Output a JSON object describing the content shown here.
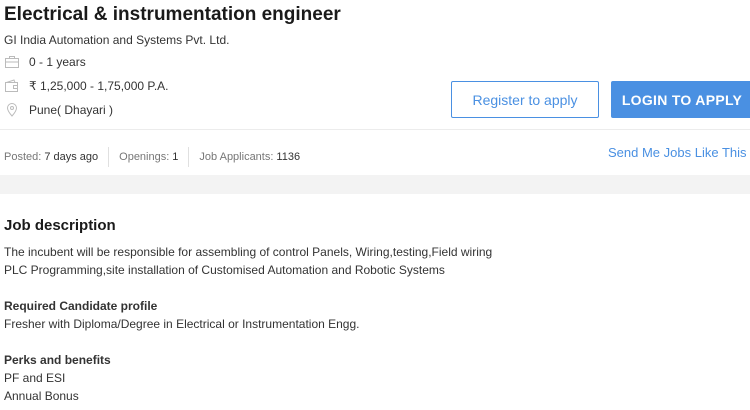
{
  "job": {
    "title": "Electrical & instrumentation engineer",
    "company": "GI India Automation and Systems Pvt. Ltd.",
    "experience": "0 - 1 years",
    "salary": "₹ 1,25,000 - 1,75,000 P.A.",
    "location": "Pune( Dhayari )"
  },
  "actions": {
    "register_label": "Register to apply",
    "login_label": "LOGIN TO APPLY",
    "send_jobs_label": "Send Me Jobs Like This"
  },
  "stats": {
    "posted_label": "Posted:",
    "posted_value": "7 days ago",
    "openings_label": "Openings:",
    "openings_value": "1",
    "applicants_label": "Job Applicants:",
    "applicants_value": "1136"
  },
  "description": {
    "heading": "Job description",
    "lines": [
      "The incubent will be responsible for assembling of control Panels, Wiring,testing,Field wiring",
      "PLC Programming,site installation of Customised Automation and Robotic Systems"
    ],
    "candidate_heading": "Required Candidate profile",
    "candidate_text": "Fresher with Diploma/Degree in Electrical or Instrumentation Engg.",
    "perks_heading": "Perks and benefits",
    "perks": [
      "PF and ESI",
      "Annual Bonus"
    ]
  },
  "icons": {
    "experience": "briefcase-icon",
    "salary": "wallet-icon",
    "location": "location-pin-icon"
  },
  "colors": {
    "accent": "#4a90e2",
    "icon_gray": "#bbbbbb"
  }
}
